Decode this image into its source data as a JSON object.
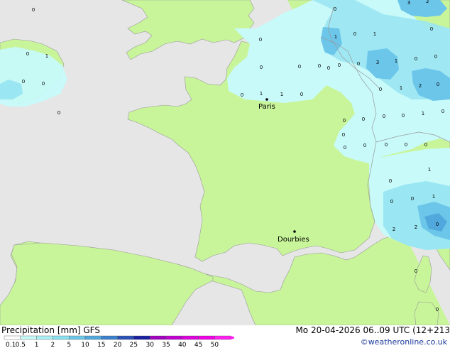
{
  "header": {
    "title": "Precipitation [mm]  GFS",
    "validity": "Mo 20-04-2026 06..09 UTC (12+213",
    "credit": "©weatheronline.co.uk"
  },
  "legend": {
    "ticks": [
      "0.1",
      "0.5",
      "1",
      "2",
      "5",
      "10",
      "15",
      "20",
      "25",
      "30",
      "35",
      "40",
      "45",
      "50"
    ],
    "colors": [
      "#ffffff",
      "#c8fafa",
      "#aaf0f5",
      "#8ae0ee",
      "#6cc8e6",
      "#50a8dc",
      "#3a80cc",
      "#2a50b8",
      "#1a20a0",
      "#a000c0",
      "#c000d0",
      "#dc00dc",
      "#f000e6",
      "#ff20f0"
    ]
  },
  "map": {
    "colors": {
      "sea": "#e6e6e6",
      "land": "#c8f59a",
      "precip_light": "#c8fafa",
      "precip_mid": "#9ae6f2",
      "precip_heavy": "#6cc6ea",
      "border": "#999999"
    },
    "cities": [
      {
        "name": "Paris"
      },
      {
        "name": "Dourbies"
      }
    ],
    "annotations": [
      "3",
      "3",
      "0",
      "0",
      "0",
      "0",
      "0",
      "1",
      "1",
      "0",
      "1",
      "0",
      "0",
      "0",
      "0",
      "0",
      "0",
      "3",
      "0",
      "0",
      "1",
      "0",
      "0",
      "2",
      "1",
      "0",
      "0",
      "0",
      "1",
      "1",
      "0",
      "0",
      "0",
      "0",
      "0",
      "0",
      "0",
      "0",
      "0",
      "0",
      "1",
      "0",
      "0",
      "0",
      "0",
      "1",
      "1",
      "2",
      "2",
      "0",
      "0",
      "0",
      "0",
      "0"
    ]
  }
}
